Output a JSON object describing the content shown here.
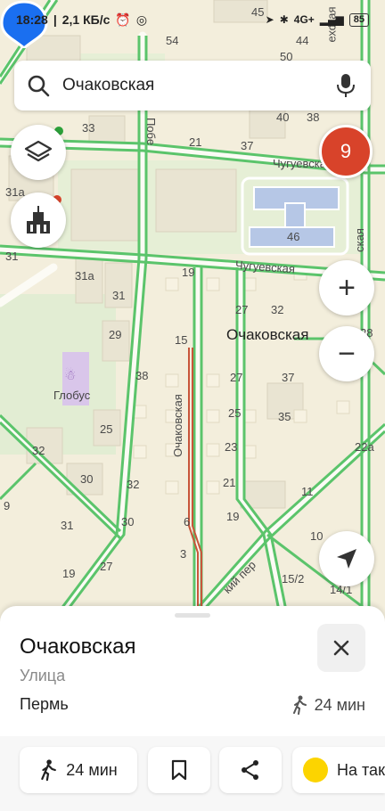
{
  "statusbar": {
    "time": "18:28",
    "speed": "2,1 КБ/с",
    "network": "4G+",
    "battery": "85"
  },
  "search": {
    "query": "Очаковская",
    "icon": "search-icon",
    "mic_icon": "mic-icon"
  },
  "map": {
    "layers_icon": "layers-icon",
    "landmarks_icon": "landmark-icon",
    "traffic_badge": "9",
    "zoom_in": "+",
    "zoom_out": "−",
    "selected_street": "Очаковская",
    "street_labels": [
      "Чугуевская",
      "Чугуевская",
      "Очаковская",
      "Побе",
      "ехская",
      "ская",
      "кий пер"
    ],
    "poi_globus": "Глобус",
    "house_numbers": [
      "45",
      "54",
      "50",
      "44",
      "40",
      "38",
      "33",
      "37",
      "21",
      "31а",
      "46",
      "31",
      "19",
      "31а",
      "32",
      "31",
      "15",
      "27",
      "37",
      "28",
      "29",
      "38",
      "27",
      "25",
      "25",
      "35",
      "22а",
      "32",
      "23",
      "30",
      "32",
      "21",
      "11",
      "31",
      "30",
      "19",
      "10",
      "19",
      "27",
      "3",
      "6",
      "15/2",
      "14/1",
      "9"
    ]
  },
  "sheet": {
    "title": "Очаковская",
    "subtitle": "Улица",
    "city": "Пермь",
    "walk_time": "24 мин",
    "close_icon": "close-icon",
    "actions": {
      "walk_label": "24 мин",
      "taxi_label": "На такси"
    }
  },
  "colors": {
    "road_green": "#5bc46b",
    "accent_blue": "#1a6ff0",
    "badge_red": "#d8432a",
    "map_bg": "#f3eedc"
  }
}
